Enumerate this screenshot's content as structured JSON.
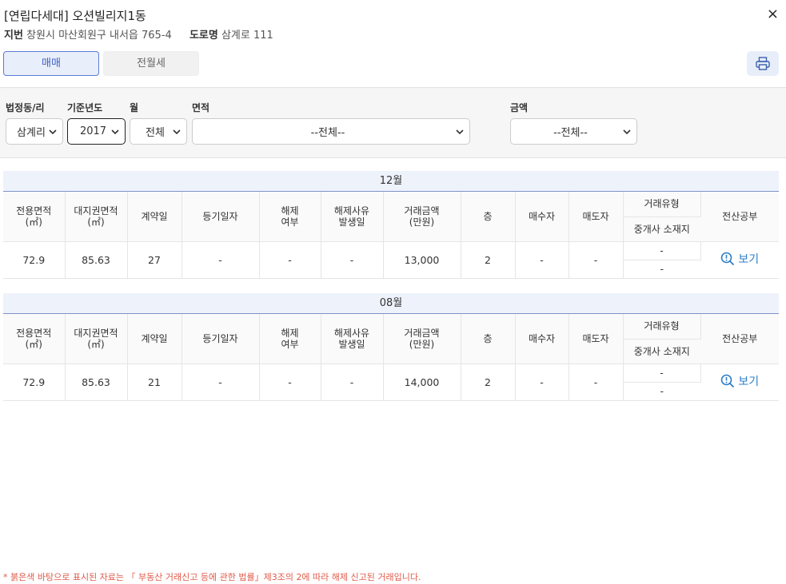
{
  "header": {
    "title": "[연립다세대] 오션빌리지1동",
    "jibun_label": "지번",
    "jibun_value": "창원시 마산회원구 내서읍 765-4",
    "road_label": "도로명",
    "road_value": "삼계로 111",
    "close": "×"
  },
  "tabs": {
    "sale": "매매",
    "rent": "전월세"
  },
  "filters": {
    "dong_label": "법정동/리",
    "dong_value": "삼계리",
    "year_label": "기준년도",
    "year_value": "2017",
    "month_label": "월",
    "month_value": "전체",
    "area_label": "면적",
    "area_value": "--전체--",
    "amount_label": "금액",
    "amount_value": "--전체--"
  },
  "columns": {
    "area": [
      "전용면적",
      "(㎡)"
    ],
    "land": [
      "대지권면적",
      "(㎡)"
    ],
    "contract_day": "계약일",
    "reg_date": "등기일자",
    "cancel": [
      "해제",
      "여부"
    ],
    "cancel_date": [
      "해제사유",
      "발생일"
    ],
    "price": [
      "거래금액",
      "(만원)"
    ],
    "floor": "층",
    "buyer": "매수자",
    "seller": "매도자",
    "deal_type": "거래유형",
    "agent_loc": "중개사 소재지",
    "registry": "전산공부"
  },
  "sections": [
    {
      "month": "12월",
      "row": {
        "area": "72.9",
        "land": "85.63",
        "day": "27",
        "reg": "-",
        "cancel": "-",
        "cancel_date": "-",
        "price": "13,000",
        "floor": "2",
        "buyer": "-",
        "seller": "-",
        "deal_type": "-",
        "agent_loc": "-",
        "view": "보기"
      }
    },
    {
      "month": "08월",
      "row": {
        "area": "72.9",
        "land": "85.63",
        "day": "21",
        "reg": "-",
        "cancel": "-",
        "cancel_date": "-",
        "price": "14,000",
        "floor": "2",
        "buyer": "-",
        "seller": "-",
        "deal_type": "-",
        "agent_loc": "-",
        "view": "보기"
      }
    }
  ],
  "footnote": "* 붉은색 바탕으로 표시된 자료는 「 부동산 거래신고 등에 관한 법률」제3조의 2에 따라 해제 신고된 거래입니다.",
  "colors": {
    "accent": "#3f5fc0",
    "link": "#2f7ec7",
    "warning": "#e05a4a"
  }
}
